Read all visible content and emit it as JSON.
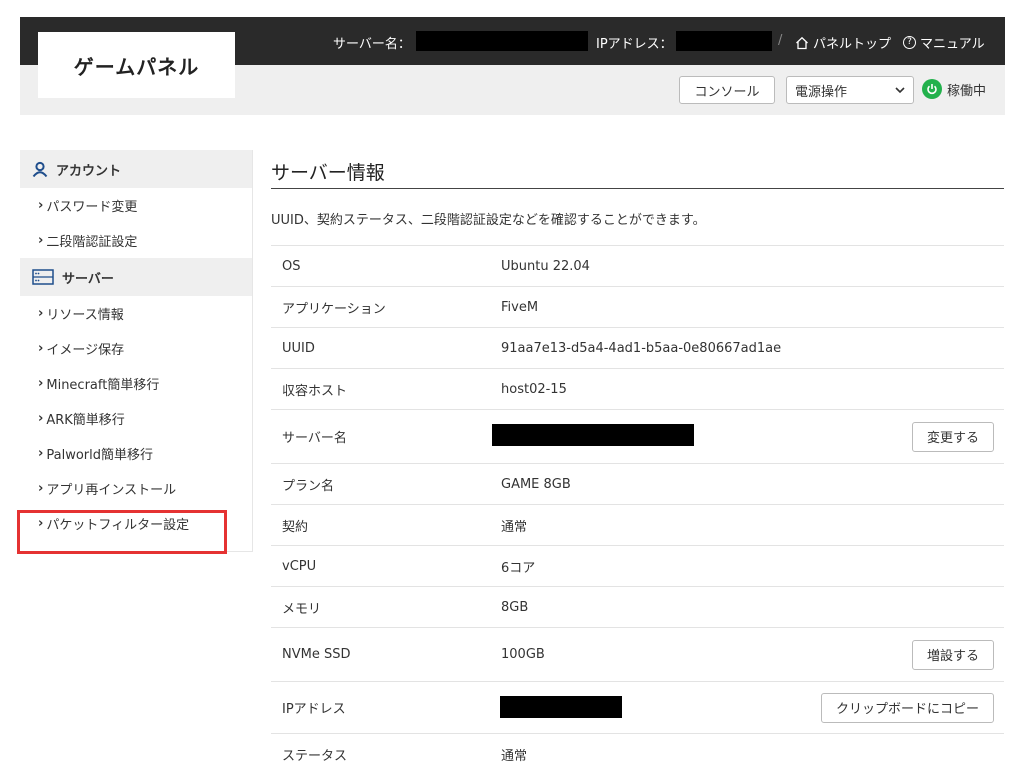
{
  "header": {
    "logo": "ゲームパネル",
    "server_name_label": "サーバー名：",
    "ip_label": "IPアドレス：",
    "separator": "/",
    "panel_top": "パネルトップ",
    "manual": "マニュアル",
    "console_button": "コンソール",
    "power_select": "電源操作",
    "status": "稼働中",
    "colors": {
      "topbar": "#2a2a2a",
      "status_green": "#22b14c"
    }
  },
  "sidebar": {
    "sections": [
      {
        "title": "アカウント",
        "icon": "user-icon",
        "items": [
          "パスワード変更",
          "二段階認証設定"
        ]
      },
      {
        "title": "サーバー",
        "icon": "server-icon",
        "items": [
          "リソース情報",
          "イメージ保存",
          "Minecraft簡単移行",
          "ARK簡単移行",
          "Palworld簡単移行",
          "アプリ再インストール",
          "パケットフィルター設定"
        ]
      }
    ],
    "highlighted_item": "パケットフィルター設定",
    "highlight_color": "#e53232"
  },
  "main": {
    "title": "サーバー情報",
    "description": "UUID、契約ステータス、二段階認証設定などを確認することができます。",
    "rows": [
      {
        "label": "OS",
        "value": "Ubuntu 22.04"
      },
      {
        "label": "アプリケーション",
        "value": "FiveM"
      },
      {
        "label": "UUID",
        "value": "91aa7e13-d5a4-4ad1-b5aa-0e80667ad1ae"
      },
      {
        "label": "収容ホスト",
        "value": "host02-15"
      },
      {
        "label": "サーバー名",
        "value": "",
        "action": "変更する"
      },
      {
        "label": "プラン名",
        "value": "GAME 8GB"
      },
      {
        "label": "契約",
        "value": "通常"
      },
      {
        "label": "vCPU",
        "value": "6コア"
      },
      {
        "label": "メモリ",
        "value": "8GB"
      },
      {
        "label": "NVMe SSD",
        "value": "100GB",
        "action": "増設する"
      },
      {
        "label": "IPアドレス",
        "value": "",
        "action": "クリップボードにコピー"
      },
      {
        "label": "ステータス",
        "value": "通常"
      }
    ]
  }
}
